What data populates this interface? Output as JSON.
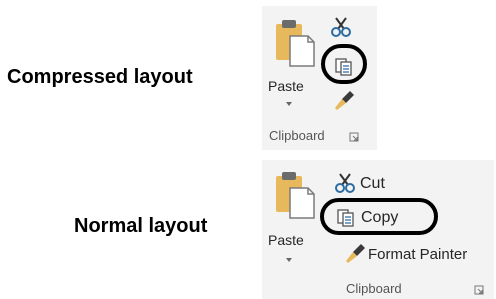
{
  "labels": {
    "compressed": "Compressed layout",
    "normal": "Normal layout"
  },
  "compressed": {
    "paste_label": "Paste",
    "group_label": "Clipboard",
    "icons": [
      "paste-icon",
      "cut-icon",
      "copy-icon",
      "format-painter-icon",
      "dialog-launcher-icon"
    ]
  },
  "normal": {
    "paste_label": "Paste",
    "cut_label": "Cut",
    "copy_label": "Copy",
    "format_painter_label": "Format Painter",
    "group_label": "Clipboard",
    "icons": [
      "paste-icon",
      "cut-icon",
      "copy-icon",
      "format-painter-icon",
      "dialog-launcher-icon"
    ]
  },
  "colors": {
    "panel_bg": "#f3f3f3",
    "clipboard_tan": "#e8b85c",
    "highlight": "#000000"
  }
}
